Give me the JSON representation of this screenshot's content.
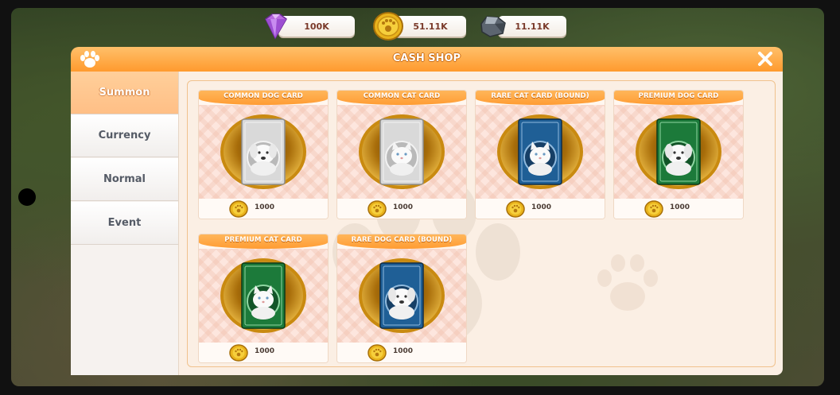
{
  "currencies": {
    "gems": "100K",
    "gold": "51.11K",
    "ore": "11.11K"
  },
  "dialog": {
    "title": "CASH SHOP",
    "close_icon": "close-icon"
  },
  "tabs": [
    {
      "label": "Summon",
      "active": true
    },
    {
      "label": "Currency",
      "active": false
    },
    {
      "label": "Normal",
      "active": false
    },
    {
      "label": "Event",
      "active": false
    }
  ],
  "cards": [
    {
      "title": "COMMON DOG CARD",
      "price": "1000",
      "frame": "silver",
      "animal": "dog"
    },
    {
      "title": "COMMON CAT CARD",
      "price": "1000",
      "frame": "silver",
      "animal": "cat"
    },
    {
      "title": "RARE CAT CARD (BOUND)",
      "price": "1000",
      "frame": "blue",
      "animal": "cat"
    },
    {
      "title": "PREMIUM DOG CARD",
      "price": "1000",
      "frame": "green",
      "animal": "dog"
    },
    {
      "title": "PREMIUM CAT CARD",
      "price": "1000",
      "frame": "green",
      "animal": "cat"
    },
    {
      "title": "RARE DOG CARD (BOUND)",
      "price": "1000",
      "frame": "blue",
      "animal": "dog"
    }
  ],
  "colors": {
    "accent_orange": "#ff9c33",
    "silver": "#c9c9c9",
    "blue": "#1f5f96",
    "green": "#1c7a3a"
  }
}
